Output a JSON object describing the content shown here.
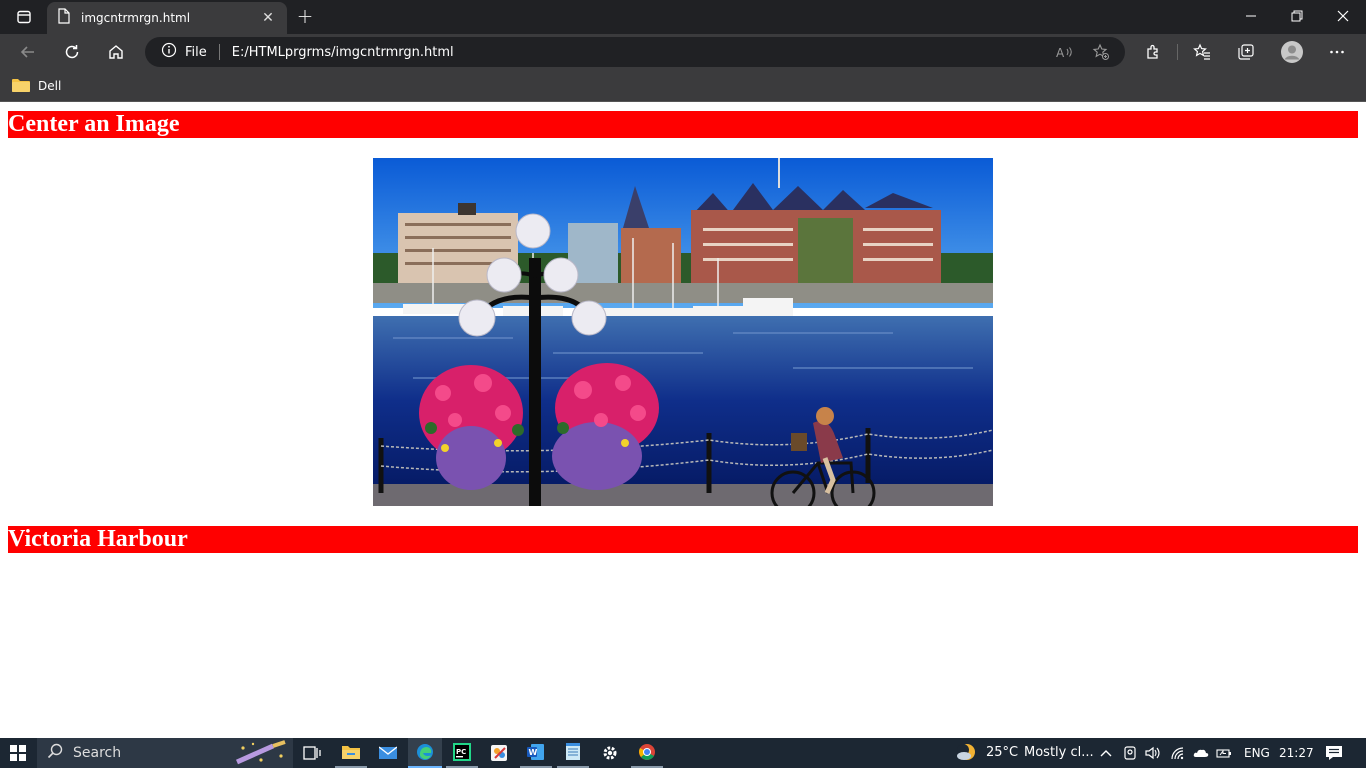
{
  "browser": {
    "tab_title": "imgcntrmrgn.html",
    "tab_close": "✕",
    "new_tab": "+",
    "address_scheme_label": "File",
    "address_url": "E:/HTMLprgrms/imgcntrmrgn.html",
    "bookmark_folder": "Dell"
  },
  "page": {
    "heading_top": "Center an Image",
    "heading_bottom": "Victoria Harbour",
    "heading_bg_color": "#ff0000",
    "heading_text_color": "#ffffff"
  },
  "taskbar": {
    "search_label": "Search",
    "weather_temp": "25°C",
    "weather_text": "Mostly cl...",
    "language": "ENG",
    "time": "21:27"
  }
}
